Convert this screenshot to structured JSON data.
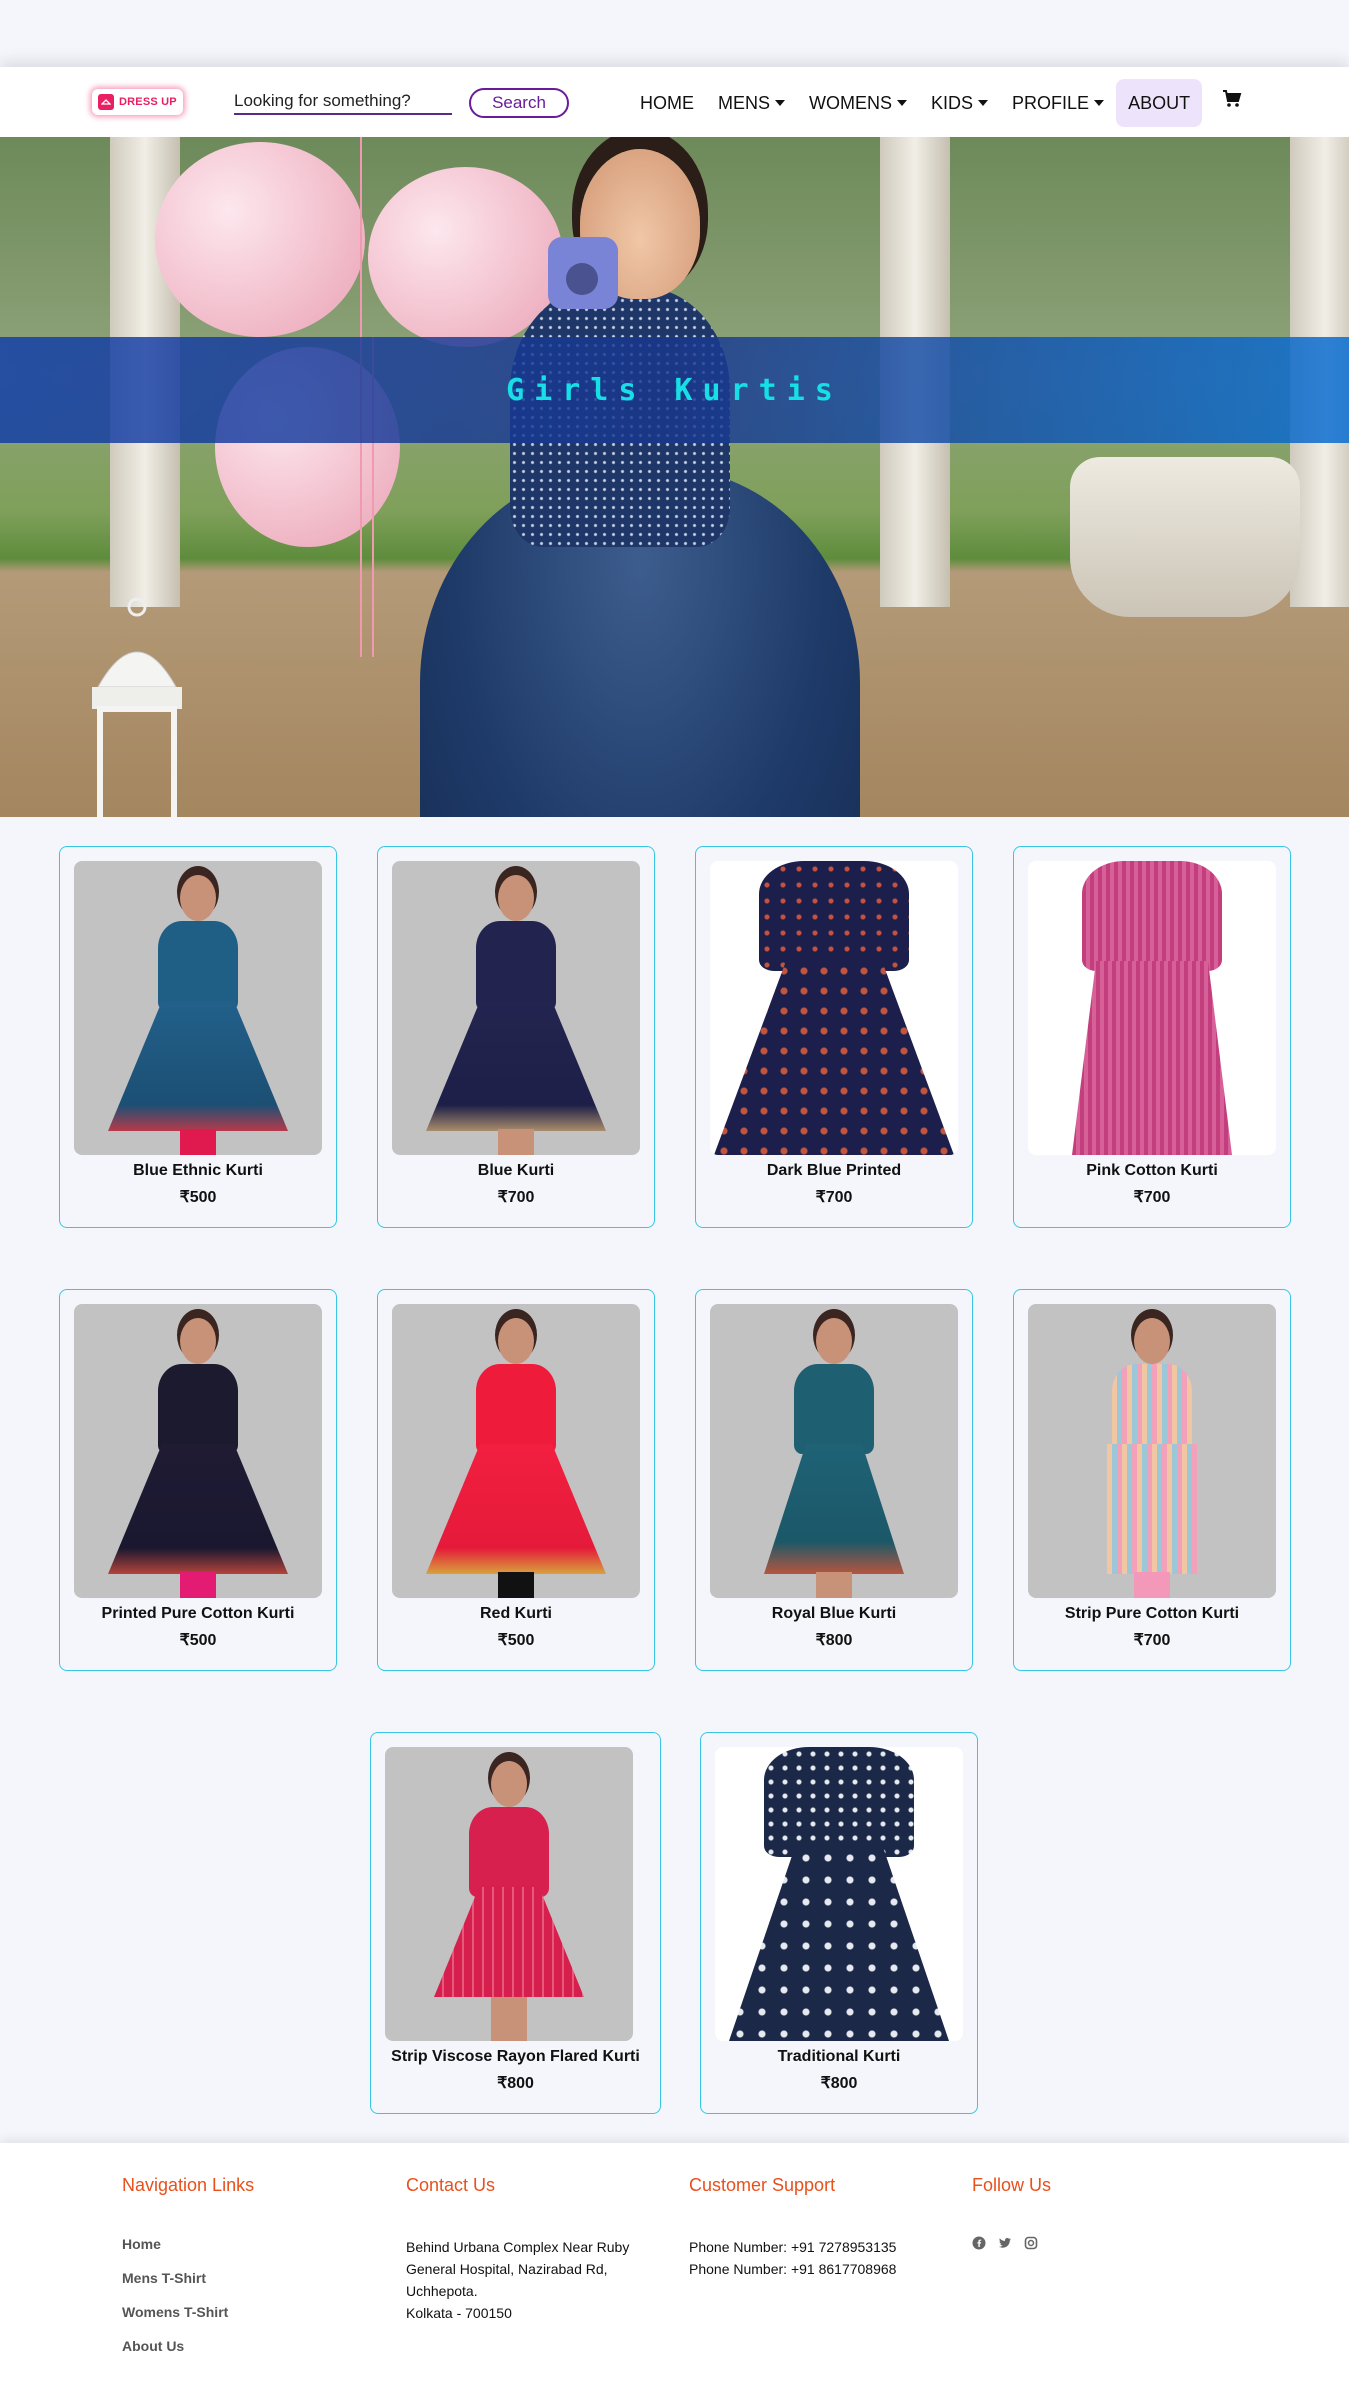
{
  "nav": {
    "logo_text": "DRESS UP",
    "search_placeholder": "Looking for something?",
    "search_button": "Search",
    "items": [
      {
        "label": "HOME",
        "dropdown": false
      },
      {
        "label": "MENS",
        "dropdown": true
      },
      {
        "label": "WOMENS",
        "dropdown": true
      },
      {
        "label": "KIDS",
        "dropdown": true
      },
      {
        "label": "PROFILE",
        "dropdown": true
      },
      {
        "label": "ABOUT",
        "dropdown": false,
        "active": true
      }
    ],
    "cart_icon": "cart-icon"
  },
  "hero": {
    "title": "Girls Kurtis"
  },
  "products": [
    {
      "name": "Blue Ethnic Kurti",
      "price": "₹500"
    },
    {
      "name": "Blue Kurti",
      "price": "₹700"
    },
    {
      "name": "Dark Blue Printed",
      "price": "₹700"
    },
    {
      "name": "Pink Cotton Kurti",
      "price": "₹700"
    },
    {
      "name": "Printed Pure Cotton Kurti",
      "price": "₹500"
    },
    {
      "name": "Red Kurti",
      "price": "₹500"
    },
    {
      "name": "Royal Blue Kurti",
      "price": "₹800"
    },
    {
      "name": "Strip Pure Cotton Kurti",
      "price": "₹700"
    },
    {
      "name": "Strip Viscose Rayon Flared Kurti",
      "price": "₹800"
    },
    {
      "name": "Traditional Kurti",
      "price": "₹800"
    }
  ],
  "footer": {
    "nav_heading": "Navigation Links",
    "nav_links": [
      "Home",
      "Mens T-Shirt",
      "Womens T-Shirt",
      "About Us"
    ],
    "contact_heading": "Contact Us",
    "contact_lines": [
      "Behind Urbana Complex Near Ruby",
      "General Hospital, Nazirabad Rd,",
      "Uchhepota.",
      "Kolkata - 700150"
    ],
    "support_heading": "Customer Support",
    "support_lines": [
      "Phone Number: +91 7278953135",
      "Phone Number: +91 8617708968"
    ],
    "follow_heading": "Follow Us",
    "social_icons": [
      "facebook-icon",
      "twitter-icon",
      "instagram-icon"
    ]
  }
}
